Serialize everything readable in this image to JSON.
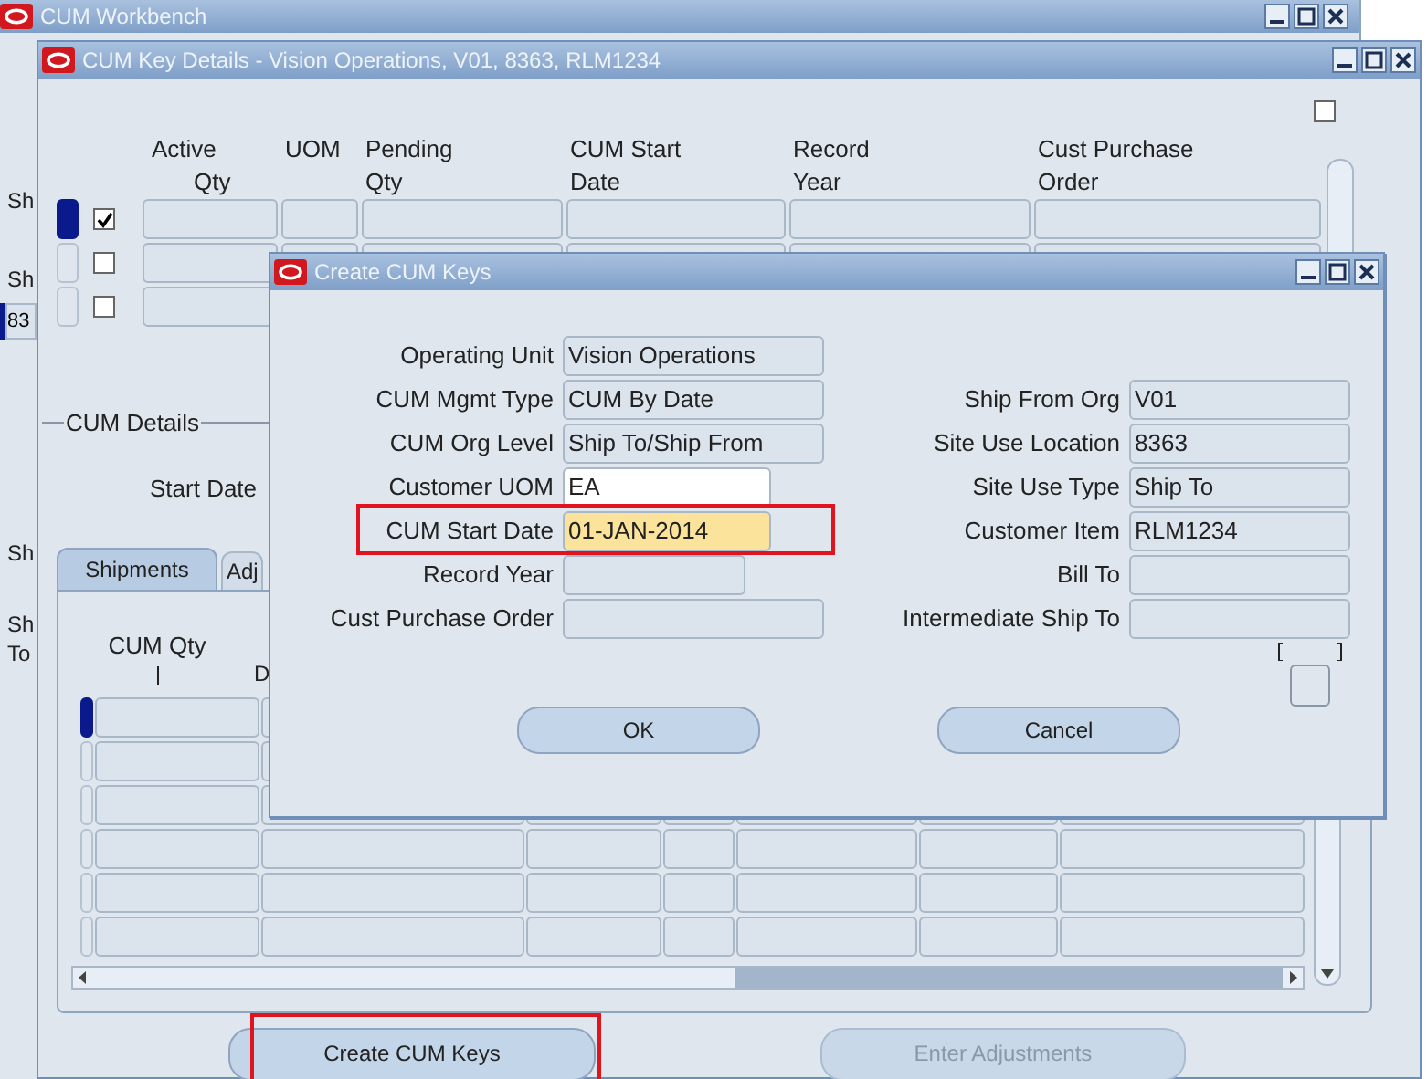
{
  "workbench": {
    "title": "CUM Workbench",
    "edge_texts": [
      "Sh",
      "Sh",
      "Sh",
      "Sh",
      "To"
    ],
    "edge_value": "83"
  },
  "details": {
    "title": "CUM Key Details - Vision Operations, V01, 8363, RLM1234",
    "top_checkbox": {
      "checked": false
    },
    "columns": [
      {
        "lines": [
          "Active",
          "Qty"
        ]
      },
      {
        "lines": [
          "UOM"
        ]
      },
      {
        "lines": [
          "Pending",
          "Qty"
        ]
      },
      {
        "lines": [
          "CUM Start",
          "Date"
        ]
      },
      {
        "lines": [
          "Record",
          "Year"
        ]
      },
      {
        "lines": [
          "Cust Purchase",
          "Order"
        ]
      }
    ],
    "rows": [
      {
        "active": true,
        "selected": true
      },
      {
        "active": false,
        "selected": false
      },
      {
        "active": false,
        "selected": false
      }
    ],
    "section_label": "CUM Details",
    "start_date_label": "Start Date",
    "tabs": [
      {
        "label": "Shipments",
        "selected": true
      },
      {
        "label": "Adj",
        "selected": false
      }
    ],
    "shipments": {
      "columns": [
        "CUM Qty",
        "D"
      ],
      "rows": [
        {
          "selected": true
        },
        {
          "selected": false
        },
        {
          "selected": false
        },
        {
          "selected": false
        },
        {
          "selected": false
        },
        {
          "selected": false
        }
      ]
    },
    "buttons": [
      {
        "label": "Create CUM Keys",
        "disabled": false,
        "highlighted": true
      },
      {
        "label": "Enter Adjustments",
        "disabled": true,
        "highlighted": false
      }
    ]
  },
  "dialog": {
    "title": "Create CUM Keys",
    "left_fields": [
      {
        "label": "Operating Unit",
        "value": "Vision Operations",
        "kind": "readonly",
        "highlighted": false
      },
      {
        "label": "CUM Mgmt Type",
        "value": "CUM By Date",
        "kind": "readonly",
        "highlighted": false
      },
      {
        "label": "CUM Org Level",
        "value": "Ship To/Ship From",
        "kind": "readonly",
        "highlighted": false
      },
      {
        "label": "Customer UOM",
        "value": "EA",
        "kind": "editable",
        "highlighted": false
      },
      {
        "label": "CUM Start Date",
        "value": "01-JAN-2014",
        "kind": "current",
        "highlighted": true
      },
      {
        "label": "Record Year",
        "kind": "readonly",
        "highlighted": false
      },
      {
        "label": "Cust Purchase Order",
        "kind": "readonly",
        "highlighted": false
      }
    ],
    "right_fields": [
      {
        "label": "Ship From Org",
        "value": "V01"
      },
      {
        "label": "Site Use Location",
        "value": "8363"
      },
      {
        "label": "Site Use Type",
        "value": "Ship To"
      },
      {
        "label": "Customer Item",
        "value": "RLM1234"
      },
      {
        "label": "Bill To"
      },
      {
        "label": "Intermediate Ship To"
      }
    ],
    "buttons": [
      {
        "label": "OK"
      },
      {
        "label": "Cancel"
      }
    ]
  }
}
